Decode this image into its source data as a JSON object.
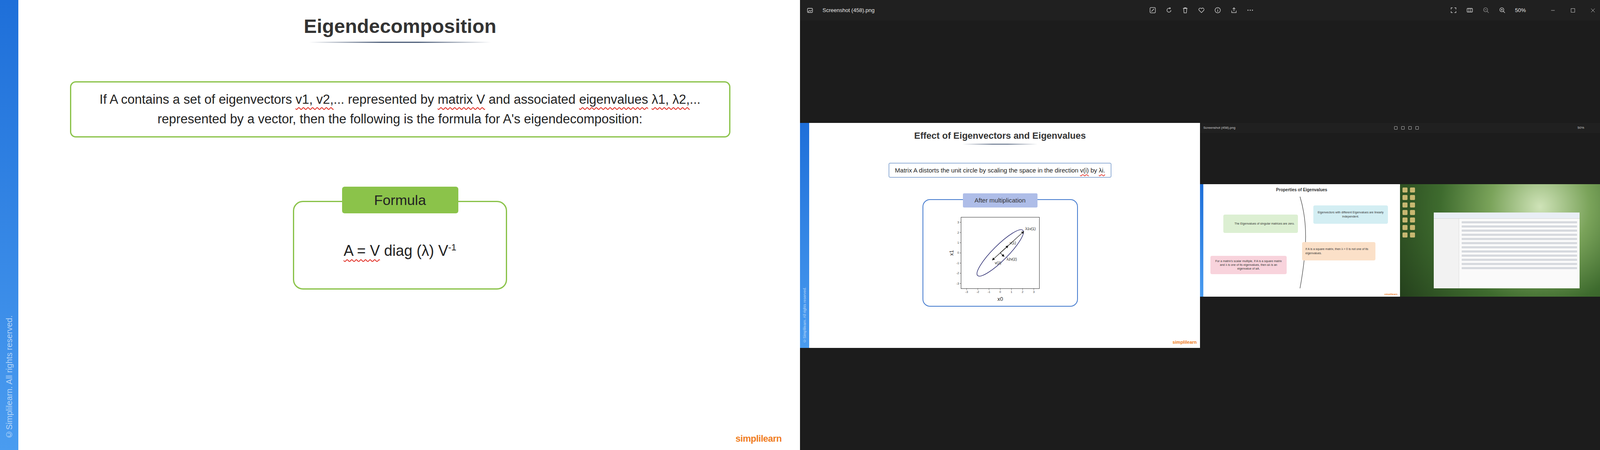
{
  "lecture_slide": {
    "title": "Eigendecomposition",
    "intro": [
      {
        "text": "If A contains a set of eigenvectors ",
        "annotated": false
      },
      {
        "text": "v1, v2,",
        "annotated": true
      },
      {
        "text": "... represented by ",
        "annotated": false
      },
      {
        "text": "matrix V",
        "annotated": true
      },
      {
        "text": " and associated ",
        "annotated": false
      },
      {
        "text": "eigenvalues",
        "annotated": true
      },
      {
        "text": " ",
        "annotated": false
      },
      {
        "text": "λ1, λ2,",
        "annotated": true
      },
      {
        "text": "... represented by a vector, then the following is the formula for A's eigendecomposition:",
        "annotated": false
      }
    ],
    "formula_label": "Formula",
    "formula": [
      {
        "text": "A = V",
        "annotated": true
      },
      {
        "text": " diag (λ) V",
        "annotated": false
      }
    ],
    "formula_power": "-1",
    "copyright": "©Simplilearn. All rights reserved.",
    "logo": "simplilearn"
  },
  "viewer": {
    "title": "Screenshot (458).png",
    "zoom": "50%",
    "image": {
      "slide": {
        "title": "Effect of Eigenvectors and Eigenvalues",
        "caption": [
          {
            "text": "Matrix A distorts the unit circle by scaling the space in the direction ",
            "annotated": false
          },
          {
            "text": "v(i)",
            "annotated": true
          },
          {
            "text": " by ",
            "annotated": false
          },
          {
            "text": "λi.",
            "annotated": true
          }
        ],
        "copyright": "©Simplilearn. All rights reserved.",
        "logo": "simplilearn",
        "chart": {
          "label": "After multiplication",
          "x_label": "x0",
          "y_label": "x1",
          "x_ticks": [
            "-3",
            "-2",
            "-1",
            "0",
            "1",
            "2",
            "3"
          ],
          "y_ticks": [
            "3",
            "2",
            "1",
            "0",
            "-1",
            "-2",
            "-3"
          ],
          "ellipse": {
            "a": 3,
            "b": 0.5,
            "angle": 45
          },
          "vectors": [
            {
              "label": "λ1v(1)",
              "x": 2.1,
              "y": 2.1
            },
            {
              "label": "v(1)",
              "x": 0.7,
              "y": 0.7
            },
            {
              "label": "v(2)",
              "x": -0.7,
              "y": -0.7
            },
            {
              "label": "λ2v(2)",
              "x": 0.35,
              "y": -0.35
            }
          ]
        }
      },
      "nested_viewer": {
        "title": "Screenshot (458).png",
        "zoom": "50%",
        "slide": {
          "title": "Properties of Eigenvalues",
          "properties": [
            {
              "text": "Eigenvectors with different Eigenvalues are linearly independent.",
              "color": "#d3eef3"
            },
            {
              "text": "The Eigenvalues of singular matrices are zero.",
              "color": "#dcefd2"
            },
            {
              "text": "If A is a square matrix, then λ = 0 is not one of its eigenvalues.",
              "color": "#fbe0c8"
            },
            {
              "text": "For a matrix's scalar multiple, If A is a square matrix and λ is one of its eigenvalues, then aλ is an eigenvalue of aA.",
              "color": "#f8d3dc"
            }
          ],
          "logo": "simplilearn"
        }
      }
    }
  }
}
